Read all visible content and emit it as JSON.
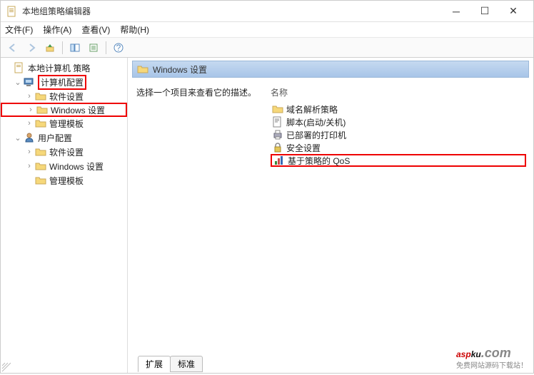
{
  "window": {
    "title": "本地组策略编辑器"
  },
  "menu": {
    "file": "文件(F)",
    "action": "操作(A)",
    "view": "查看(V)",
    "help": "帮助(H)"
  },
  "tree": {
    "root": "本地计算机 策略",
    "computer": "计算机配置",
    "c_soft": "软件设置",
    "c_win": "Windows 设置",
    "c_admin": "管理模板",
    "user": "用户配置",
    "u_soft": "软件设置",
    "u_win": "Windows 设置",
    "u_admin": "管理模板"
  },
  "pane": {
    "header": "Windows 设置",
    "desc_prompt": "选择一个项目来查看它的描述。",
    "col_name": "名称",
    "items": {
      "dns": "域名解析策略",
      "scripts": "脚本(启动/关机)",
      "printers": "已部署的打印机",
      "security": "安全设置",
      "qos": "基于策略的 QoS"
    }
  },
  "tabs": {
    "extended": "扩展",
    "standard": "标准"
  },
  "watermark": {
    "a": "asp",
    "b": "ku",
    "c": ".com",
    "sub": "免费网站源码下载站！"
  }
}
